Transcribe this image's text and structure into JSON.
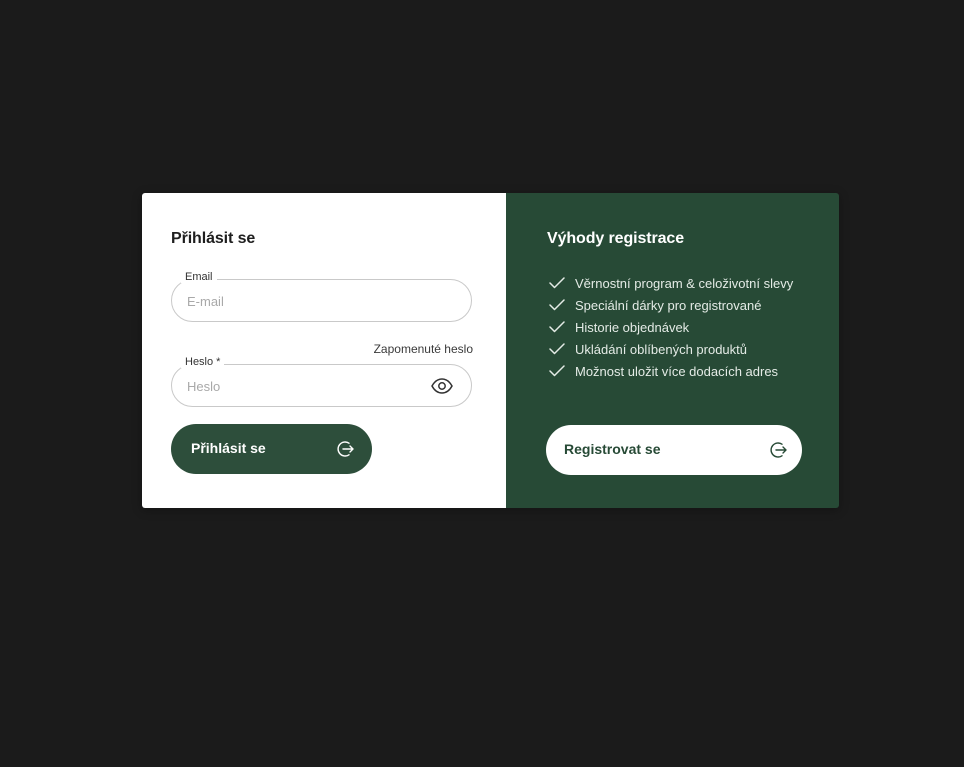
{
  "login": {
    "title": "Přihlásit se",
    "email": {
      "label": "Email",
      "placeholder": "E-mail",
      "value": ""
    },
    "password": {
      "label": "Heslo *",
      "placeholder": "Heslo",
      "value": ""
    },
    "forgot_label": "Zapomenuté heslo",
    "submit_label": "Přihlásit se"
  },
  "register": {
    "title": "Výhody registrace",
    "benefits": [
      "Věrnostní program & celoživotní slevy",
      "Speciální dárky pro registrované",
      "Historie objednávek",
      "Ukládání oblíbených produktů",
      "Možnost uložit více dodacích adres"
    ],
    "button_label": "Registrovat se"
  },
  "icons": {
    "password_toggle": "eye-icon",
    "login_arrow": "arrow-right-circle-icon",
    "benefit_marker": "check-icon",
    "register_arrow": "arrow-right-circle-icon"
  },
  "colors": {
    "background": "#1b1b1b",
    "accent_green": "#274a36",
    "button_green": "#2d4e3b",
    "panel_white": "#ffffff"
  }
}
